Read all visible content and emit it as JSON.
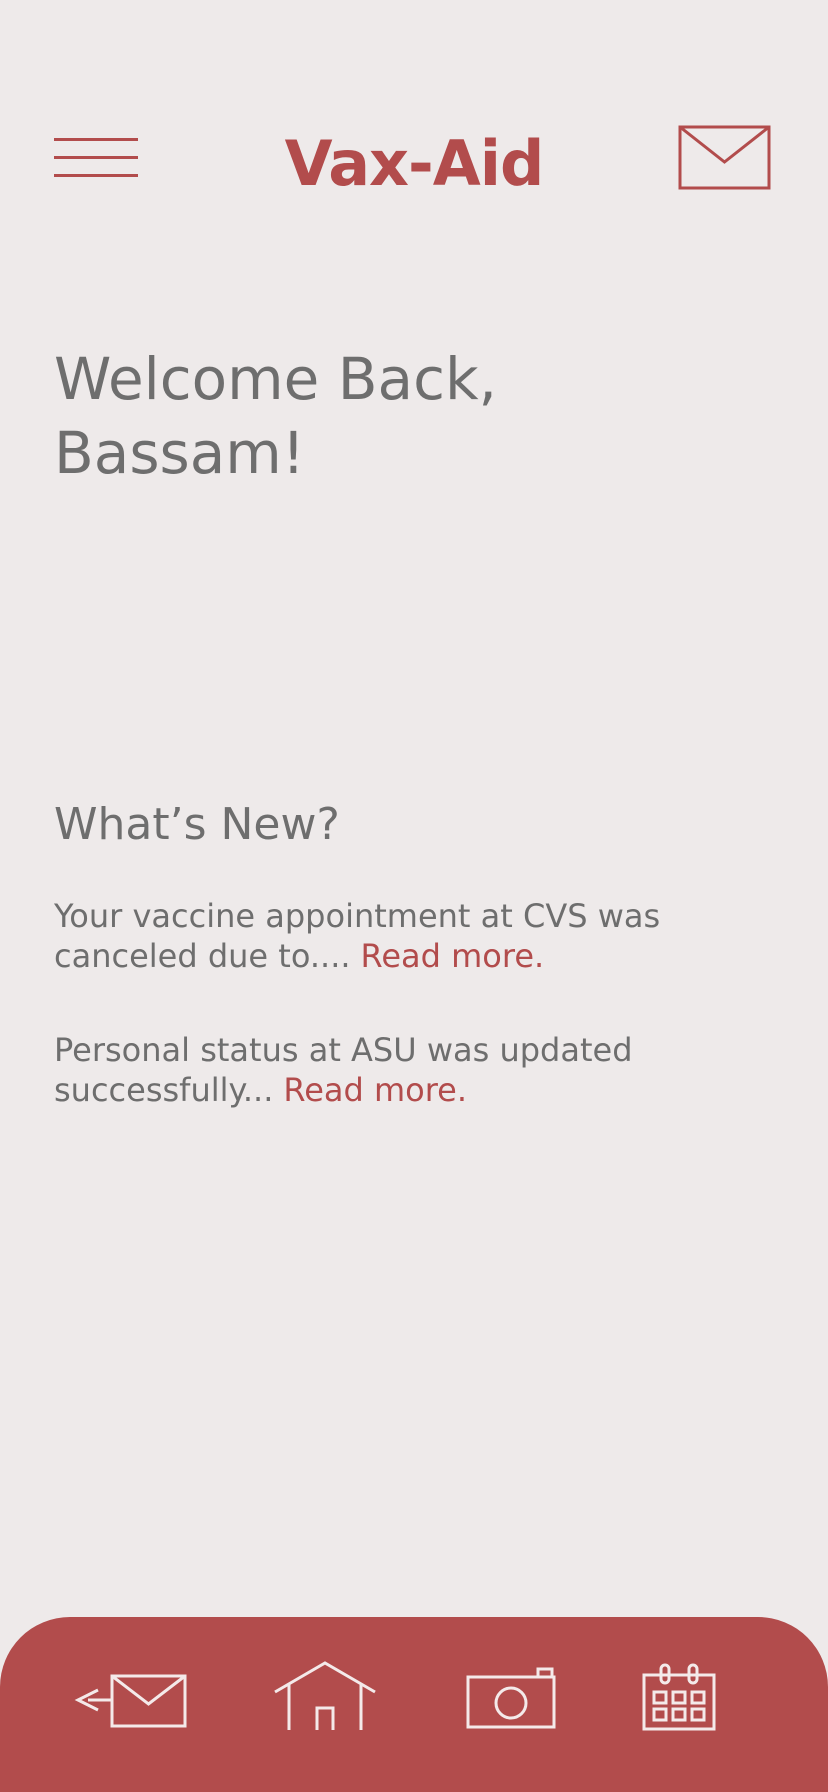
{
  "header": {
    "title": "Vax-Aid",
    "menu_icon": "hamburger-menu-icon",
    "mail_icon": "envelope-icon"
  },
  "welcome": {
    "line1": "Welcome Back,",
    "line2": "Bassam!"
  },
  "news": {
    "title": "What’s New?",
    "items": [
      {
        "text": "Your vaccine appointment at CVS was canceled due to....",
        "link": "Read more."
      },
      {
        "text": "Personal status at ASU was updated successfully...",
        "link": "Read more."
      }
    ]
  },
  "tabbar": {
    "items": [
      {
        "icon": "send-message-icon"
      },
      {
        "icon": "home-icon"
      },
      {
        "icon": "camera-icon"
      },
      {
        "icon": "calendar-icon"
      }
    ]
  },
  "colors": {
    "accent": "#b24c4c",
    "background": "#eeeaea",
    "text": "#6e6e6e",
    "tab_icon": "#f4eaea"
  }
}
